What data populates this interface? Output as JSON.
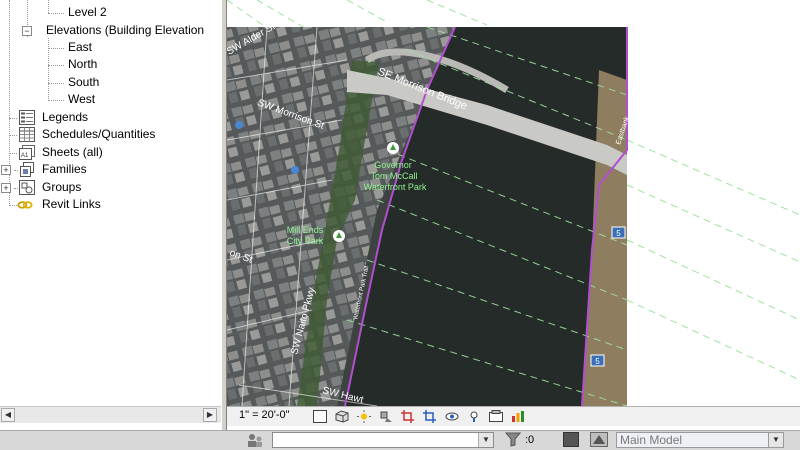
{
  "project_browser": {
    "items": [
      {
        "label": "Level 2",
        "icon": "none"
      },
      {
        "label": "Elevations (Building Elevation",
        "icon": "none"
      },
      {
        "label": "East",
        "icon": "none"
      },
      {
        "label": "North",
        "icon": "none"
      },
      {
        "label": "South",
        "icon": "none"
      },
      {
        "label": "West",
        "icon": "none"
      },
      {
        "label": "Legends",
        "icon": "legends-icon"
      },
      {
        "label": "Schedules/Quantities",
        "icon": "schedules-icon"
      },
      {
        "label": "Sheets (all)",
        "icon": "sheets-icon"
      },
      {
        "label": "Families",
        "icon": "families-icon"
      },
      {
        "label": "Groups",
        "icon": "groups-icon"
      },
      {
        "label": "Revit Links",
        "icon": "revit-links-icon"
      }
    ]
  },
  "map": {
    "labels": {
      "sw_alder": "SW Alder St",
      "morrison_bridge": "SE Morrison Bridge",
      "sw_morrison": "SW Morrison St",
      "park_name": "Governor Tom McCall Waterfront Park",
      "park_line1": "Governor",
      "park_line2": "Tom McCall",
      "park_line3": "Waterfront Park",
      "mill_ends_line1": "Mill Ends",
      "mill_ends_line2": "City Park",
      "salmon": "on St",
      "naito": "SW Naito Pkwy",
      "hawthorne": "SW Hawt",
      "waterfront_path": "Waterfront Park Trail",
      "eastbank": "Eastbank",
      "shield_top": "5",
      "shield_bottom": "5"
    },
    "colors": {
      "crop_boundary": "#b24fd0",
      "elevation_lines": "#9fe39f",
      "river": "#252b29",
      "park": "#3e5b33"
    }
  },
  "view_control_bar": {
    "scale": "1\" = 20'-0\"",
    "icons": [
      "detail-level-icon",
      "visual-style-icon",
      "sun-path-icon",
      "shadows-icon",
      "crop-view-icon",
      "show-crop-icon",
      "temporary-hide-icon",
      "reveal-hidden-icon",
      "temporary-view-properties-icon",
      "analysis-display-icon",
      "highlight-displacement-icon",
      "reveal-constraints-icon"
    ]
  },
  "status_bar": {
    "workset_value": "",
    "selection_count": ":0",
    "design_option": "Main Model"
  }
}
